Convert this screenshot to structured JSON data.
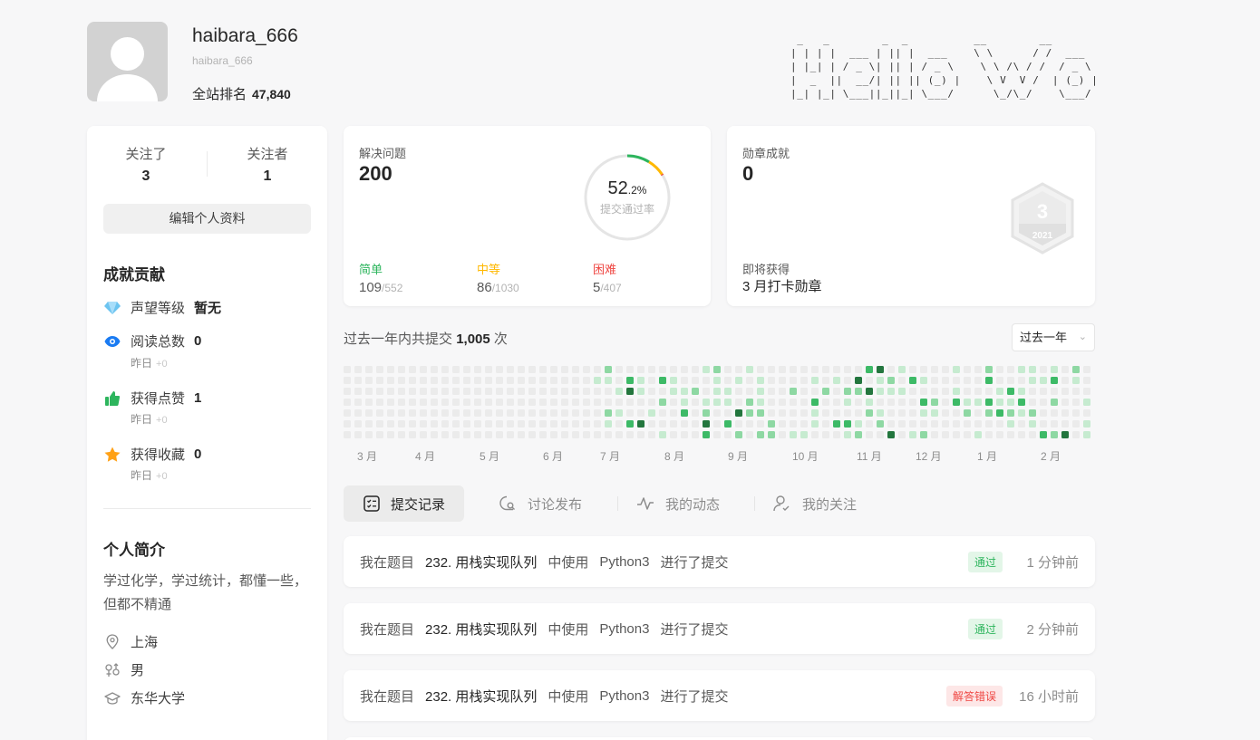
{
  "profile": {
    "username": "haibara_666",
    "handle": "haibara_666",
    "rank_label": "全站排名",
    "rank_value": "47,840",
    "ascii_art": " _   _        _  _          __        __              _      _ \n| | | |  ___ | || |  ___    \\ \\      / /  ___   _ __ | |  __| |\n| |_| | / _ \\| || | / _ \\    \\ \\ /\\ / /  / _ \\ | '__|| | / _` |\n|  _  ||  __/| || || (_) |    \\ V  V /  | (_) || |   | || (_| |\n|_| |_| \\___||_||_| \\___/      \\_/\\_/    \\___/ |_|   |_| \\__,_|"
  },
  "follow": {
    "following_label": "关注了",
    "following_count": "3",
    "followers_label": "关注者",
    "followers_count": "1",
    "edit_label": "编辑个人资料"
  },
  "achievements": {
    "title": "成就贡献",
    "reputation_label": "声望等级",
    "reputation_value": "暂无",
    "reads_label": "阅读总数",
    "reads_value": "0",
    "likes_label": "获得点赞",
    "likes_value": "1",
    "favs_label": "获得收藏",
    "favs_value": "0",
    "yesterday_label": "昨日",
    "yesterday_delta": "+0"
  },
  "bio": {
    "title": "个人简介",
    "text": "学过化学，学过统计，都懂一些，但都不精通",
    "location": "上海",
    "gender": "男",
    "school": "东华大学"
  },
  "solved": {
    "label": "解决问题",
    "count": "200",
    "rate_main": "52",
    "rate_decimal": ".2%",
    "rate_label": "提交通过率",
    "acceptance_fraction": 0.522,
    "easy_label": "简单",
    "easy_solved": "109",
    "easy_total": "/552",
    "medium_label": "中等",
    "medium_solved": "86",
    "medium_total": "/1030",
    "hard_label": "困难",
    "hard_solved": "5",
    "hard_total": "/407",
    "colors": {
      "easy": "#2db55d",
      "medium": "#ffb800",
      "hard": "#ef4743",
      "ring_bg": "#e5e5e5"
    }
  },
  "badges": {
    "label": "勋章成就",
    "count": "0",
    "upcoming_label": "即将获得",
    "upcoming_name": "3 月打卡勋章",
    "badge_number": "3",
    "badge_year": "2021"
  },
  "heatmap": {
    "summary_prefix": "过去一年内共提交",
    "summary_count": "1,005",
    "summary_suffix": "次",
    "range_select": "过去一年",
    "months": [
      "3 月",
      "4 月",
      "5 月",
      "6 月",
      "7 月",
      "8 月",
      "9 月",
      "10 月",
      "11 月",
      "12 月",
      "1 月",
      "2 月"
    ],
    "colors": [
      "#ebebeb",
      "#c6ebd0",
      "#8ed8a3",
      "#3dba67",
      "#23763e"
    ]
  },
  "tabs": [
    {
      "label": "提交记录",
      "icon": "checklist-icon"
    },
    {
      "label": "讨论发布",
      "icon": "comment-search-icon"
    },
    {
      "label": "我的动态",
      "icon": "activity-icon"
    },
    {
      "label": "我的关注",
      "icon": "user-check-icon"
    }
  ],
  "submissions": [
    {
      "prefix": "我在题目",
      "problem": "232. 用栈实现队列",
      "mid": "中使用",
      "lang": "Python3",
      "suffix": "进行了提交",
      "status": "通过",
      "status_type": "ok",
      "time": "1 分钟前"
    },
    {
      "prefix": "我在题目",
      "problem": "232. 用栈实现队列",
      "mid": "中使用",
      "lang": "Python3",
      "suffix": "进行了提交",
      "status": "通过",
      "status_type": "ok",
      "time": "2 分钟前"
    },
    {
      "prefix": "我在题目",
      "problem": "232. 用栈实现队列",
      "mid": "中使用",
      "lang": "Python3",
      "suffix": "进行了提交",
      "status": "解答错误",
      "status_type": "bad",
      "time": "16 小时前"
    }
  ]
}
